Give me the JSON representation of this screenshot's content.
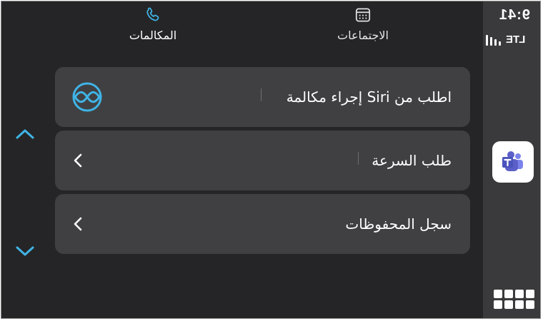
{
  "status": {
    "time": "9:41",
    "network": "LTE"
  },
  "tabs": [
    {
      "label": "المكالمات",
      "icon": "phone-icon",
      "selected": true
    },
    {
      "label": "الاجتماعات",
      "icon": "calendar-icon",
      "selected": false
    }
  ],
  "list": [
    {
      "label": "اطلب من Siri إجراء مكالمة",
      "icon": "siri-icon"
    },
    {
      "label": "طلب السرعة",
      "icon": "chevron-left-icon"
    },
    {
      "label": "سجل المحفوظات",
      "icon": "chevron-left-icon"
    }
  ],
  "scroll": {
    "up_icon": "chevron-up-icon",
    "down_icon": "chevron-down-icon"
  },
  "apps": {
    "current": "teams-icon",
    "home": "app-grid-icon"
  },
  "colors": {
    "background": "#252527",
    "rail": "#3a3a3c",
    "row": "#404043",
    "accent": "#3fb4e6",
    "teams_purple": "#5b5fc7"
  }
}
